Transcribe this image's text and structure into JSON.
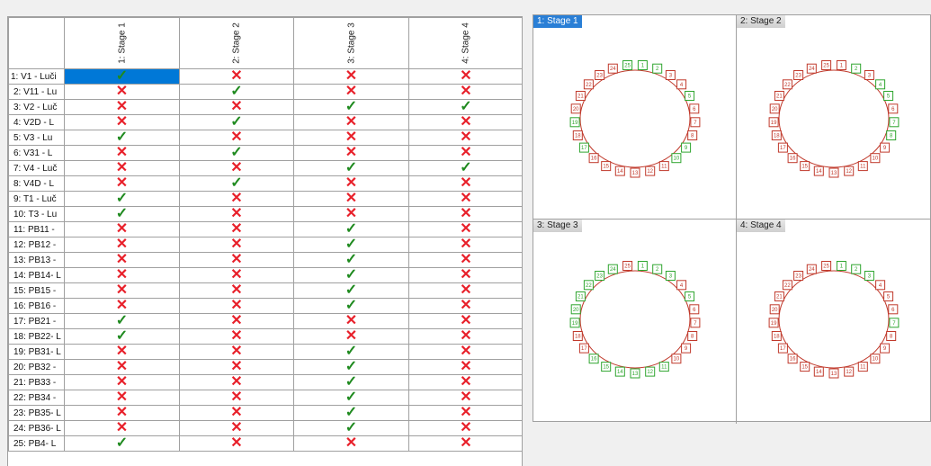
{
  "grid": {
    "columns": [
      "1: Stage 1",
      "2: Stage 2",
      "3: Stage 3",
      "4: Stage 4"
    ],
    "rows": [
      {
        "label": "1: V1 - Luči",
        "marks": [
          1,
          0,
          0,
          0
        ]
      },
      {
        "label": "2: V11 - Lu",
        "marks": [
          0,
          1,
          0,
          0
        ]
      },
      {
        "label": "3: V2 - Luč",
        "marks": [
          0,
          0,
          1,
          1
        ]
      },
      {
        "label": "4: V2D - L",
        "marks": [
          0,
          1,
          0,
          0
        ]
      },
      {
        "label": "5: V3 - Lu",
        "marks": [
          1,
          0,
          0,
          0
        ]
      },
      {
        "label": "6: V31 - L",
        "marks": [
          0,
          1,
          0,
          0
        ]
      },
      {
        "label": "7: V4 - Luč",
        "marks": [
          0,
          0,
          1,
          1
        ]
      },
      {
        "label": "8: V4D - L",
        "marks": [
          0,
          1,
          0,
          0
        ]
      },
      {
        "label": "9: T1 - Luč",
        "marks": [
          1,
          0,
          0,
          0
        ]
      },
      {
        "label": "10: T3 - Lu",
        "marks": [
          1,
          0,
          0,
          0
        ]
      },
      {
        "label": "11: PB11 -",
        "marks": [
          0,
          0,
          1,
          0
        ]
      },
      {
        "label": "12: PB12 -",
        "marks": [
          0,
          0,
          1,
          0
        ]
      },
      {
        "label": "13: PB13 -",
        "marks": [
          0,
          0,
          1,
          0
        ]
      },
      {
        "label": "14: PB14- L",
        "marks": [
          0,
          0,
          1,
          0
        ]
      },
      {
        "label": "15: PB15 -",
        "marks": [
          0,
          0,
          1,
          0
        ]
      },
      {
        "label": "16: PB16 -",
        "marks": [
          0,
          0,
          1,
          0
        ]
      },
      {
        "label": "17: PB21 -",
        "marks": [
          1,
          0,
          0,
          0
        ]
      },
      {
        "label": "18: PB22- L",
        "marks": [
          1,
          0,
          0,
          0
        ]
      },
      {
        "label": "19: PB31- L",
        "marks": [
          0,
          0,
          1,
          0
        ]
      },
      {
        "label": "20: PB32 -",
        "marks": [
          0,
          0,
          1,
          0
        ]
      },
      {
        "label": "21: PB33 -",
        "marks": [
          0,
          0,
          1,
          0
        ]
      },
      {
        "label": "22: PB34 -",
        "marks": [
          0,
          0,
          1,
          0
        ]
      },
      {
        "label": "23: PB35- L",
        "marks": [
          0,
          0,
          1,
          0
        ]
      },
      {
        "label": "24: PB36- L",
        "marks": [
          0,
          0,
          1,
          0
        ]
      },
      {
        "label": "25: PB4- L",
        "marks": [
          1,
          0,
          0,
          0
        ]
      }
    ],
    "selected_row": 0,
    "check_glyph": "✓",
    "cross_glyph": "✕"
  },
  "stages": [
    {
      "title": "1: Stage 1",
      "active": true,
      "green": [
        1,
        2,
        5,
        9,
        10,
        17,
        19,
        25
      ]
    },
    {
      "title": "2: Stage 2",
      "active": false,
      "green": [
        2,
        4,
        5,
        7,
        8
      ]
    },
    {
      "title": "3: Stage 3",
      "active": false,
      "green": [
        1,
        2,
        3,
        5,
        11,
        12,
        13,
        14,
        15,
        16,
        19,
        20,
        21,
        22,
        23,
        24
      ]
    },
    {
      "title": "4: Stage 4",
      "active": false,
      "green": [
        1,
        2,
        3,
        7
      ]
    }
  ],
  "ring_labels": [
    "1",
    "2",
    "3",
    "4",
    "5",
    "6",
    "7",
    "8",
    "9",
    "10",
    "11",
    "12",
    "13",
    "14",
    "15",
    "16",
    "17",
    "18",
    "19",
    "20",
    "21",
    "22",
    "23",
    "24",
    "25"
  ],
  "colors": {
    "ok": "#1f8a1f",
    "no": "#e8202a",
    "selected": "#0078d7",
    "node_red": "#c0392b",
    "node_green": "#2ea52e"
  }
}
